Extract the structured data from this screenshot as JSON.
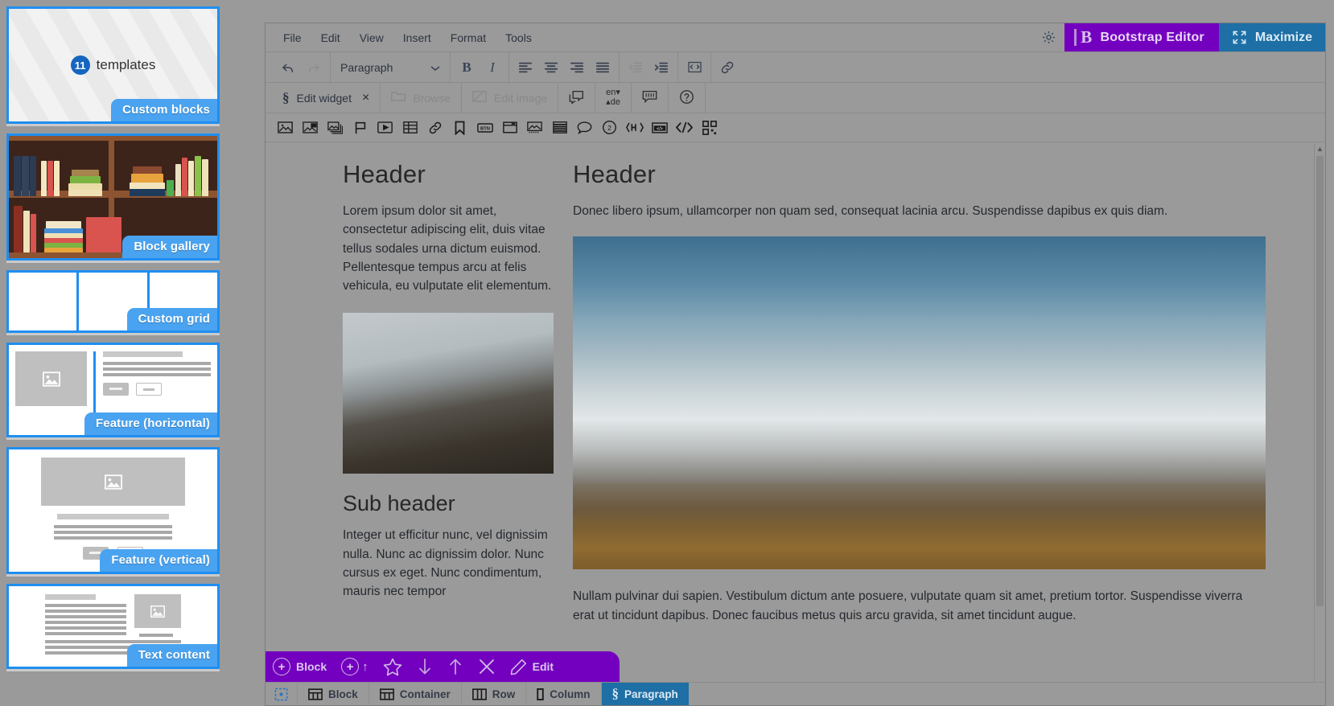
{
  "sidebar": {
    "cards": [
      {
        "id": "custom-blocks",
        "badge": "Custom blocks",
        "count": "11",
        "count_label": "templates"
      },
      {
        "id": "block-gallery",
        "badge": "Block gallery"
      },
      {
        "id": "custom-grid",
        "badge": "Custom grid"
      },
      {
        "id": "feature-horizontal",
        "badge": "Feature (horizontal)"
      },
      {
        "id": "feature-vertical",
        "badge": "Feature (vertical)"
      },
      {
        "id": "text-content",
        "badge": "Text content"
      }
    ]
  },
  "menubar": {
    "items": [
      "File",
      "Edit",
      "View",
      "Insert",
      "Format",
      "Tools"
    ],
    "gear_icon": "gear-icon",
    "brand": {
      "label": "Bootstrap Editor",
      "icon": "bootstrap-b-icon",
      "color": "#7300bf"
    },
    "maximize": {
      "label": "Maximize",
      "icon": "maximize-icon",
      "color": "#1d6fa5"
    }
  },
  "format_toolbar": {
    "undo": "undo-icon",
    "redo": "redo-icon",
    "block_format": "Paragraph",
    "bold": "B",
    "italic": "I",
    "align_left": "align-left-icon",
    "align_center": "align-center-icon",
    "align_right": "align-right-icon",
    "align_justify": "align-justify-icon",
    "outdent": "outdent-icon",
    "indent": "indent-icon",
    "source_code": "source-code-icon",
    "link": "link-icon"
  },
  "widget_bar": {
    "edit_widget": "Edit widget",
    "close": "×",
    "browse": "Browse",
    "edit_image": "Edit image",
    "lang_from": "en",
    "lang_to": "de",
    "help": "?"
  },
  "insert_bar": {
    "icons": [
      "image-icon",
      "image-settings-icon",
      "image-stack-icon",
      "flag-icon",
      "video-icon",
      "table-icon",
      "link-icon",
      "bookmark-icon",
      "button-icon",
      "window-icon",
      "media-icon",
      "layers-icon",
      "comment-icon",
      "badge-2-icon",
      "heading-code-icon",
      "embed-icon",
      "code-icon",
      "qr-icon"
    ]
  },
  "canvas": {
    "left_column": {
      "header": "Header",
      "paragraph": "Lorem ipsum dolor sit amet, consectetur adipiscing elit, duis vitae tellus sodales urna dictum euismod. Pellentesque tempus arcu at felis vehicula, eu vulputate elit elementum.",
      "image": "coastline-photo",
      "sub_header": "Sub header",
      "sub_paragraph": "Integer ut efficitur nunc, vel dignissim nulla. Nunc ac dignissim dolor. Nunc cursus ex eget. Nunc condimentum, mauris nec tempor"
    },
    "right_column": {
      "header": "Header",
      "paragraph": "Donec libero ipsum, ullamcorper non quam sed, consequat lacinia arcu. Suspendisse dapibus ex quis diam.",
      "image": "snowy-mountains-photo",
      "paragraph_below": "Nullam pulvinar dui sapien. Vestibulum dictum ante posuere, vulputate quam sit amet, pretium tortor. Suspendisse viverra erat ut tincidunt dapibus. Donec faucibus metus quis arcu gravida, sit amet tincidunt augue."
    }
  },
  "purple_toolbar": {
    "block_label": "Block",
    "add_icon": "plus-circle-icon",
    "add_above_icon": "plus-circle-up-icon",
    "star_icon": "star-icon",
    "move_down_icon": "arrow-down-icon",
    "move_up_icon": "arrow-up-icon",
    "delete_icon": "close-x-icon",
    "edit_icon": "pencil-icon",
    "edit_label": "Edit",
    "color": "#7300bf"
  },
  "statusbar": {
    "select_icon": "select-area-icon",
    "items": [
      {
        "label": "Block",
        "icon": "block-icon",
        "active": false
      },
      {
        "label": "Container",
        "icon": "container-icon",
        "active": false
      },
      {
        "label": "Row",
        "icon": "row-icon",
        "active": false
      },
      {
        "label": "Column",
        "icon": "column-icon",
        "active": false
      },
      {
        "label": "Paragraph",
        "icon": "paragraph-icon",
        "active": true
      }
    ],
    "active_color": "#1d6fa5"
  }
}
